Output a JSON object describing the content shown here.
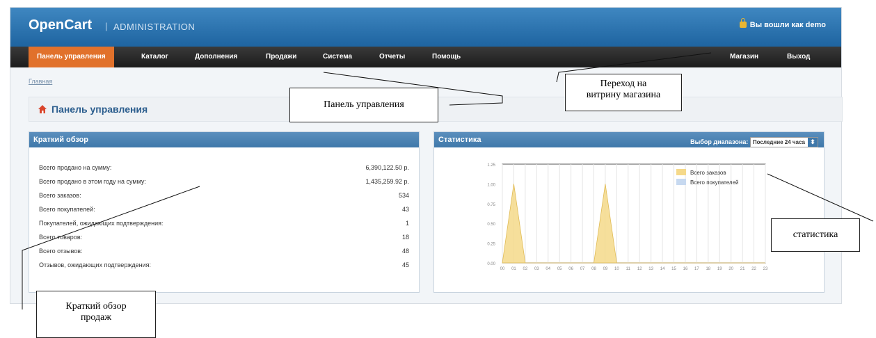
{
  "header": {
    "brand": "OpenCart",
    "separator": "|",
    "subtitle": "ADMINISTRATION",
    "login_text": "Вы вошли как demo"
  },
  "menu": {
    "items": [
      "Панель управления",
      "Каталог",
      "Дополнения",
      "Продажи",
      "Система",
      "Отчеты",
      "Помощь"
    ],
    "right": [
      "Магазин",
      "Выход"
    ]
  },
  "breadcrumb": "Главная",
  "page_title": "Панель управления",
  "overview": {
    "title": "Краткий обзор",
    "rows": [
      {
        "label": "Всего продано на сумму:",
        "value": "6,390,122.50 р."
      },
      {
        "label": "Всего продано в этом году на сумму:",
        "value": "1,435,259.92 р."
      },
      {
        "label": "Всего заказов:",
        "value": "534"
      },
      {
        "label": "Всего покупателей:",
        "value": "43"
      },
      {
        "label": "Покупателей, ожидающих подтверждения:",
        "value": "1"
      },
      {
        "label": "Всего товаров:",
        "value": "18"
      },
      {
        "label": "Всего отзывов:",
        "value": "48"
      },
      {
        "label": "Отзывов, ожидающих подтверждения:",
        "value": "45"
      }
    ]
  },
  "stats": {
    "title": "Статистика",
    "range_label": "Выбор диапазона:",
    "range_value": "Последние 24 часа"
  },
  "chart_data": {
    "type": "area",
    "x": [
      "00",
      "01",
      "02",
      "03",
      "04",
      "05",
      "06",
      "07",
      "08",
      "09",
      "10",
      "11",
      "12",
      "13",
      "14",
      "15",
      "16",
      "17",
      "18",
      "19",
      "20",
      "21",
      "22",
      "23"
    ],
    "yticks": [
      "0.00",
      "0.25",
      "0.50",
      "0.75",
      "1.00",
      "1.25"
    ],
    "ylim": [
      0,
      1.25
    ],
    "series": [
      {
        "name": "Всего заказов",
        "color": "#f5d98a",
        "values": [
          0,
          1,
          0,
          0,
          0,
          0,
          0,
          0,
          0,
          1,
          0,
          0,
          0,
          0,
          0,
          0,
          0,
          0,
          0,
          0,
          0,
          0,
          0,
          0
        ]
      },
      {
        "name": "Всего покупателей",
        "color": "#c7d9f0",
        "values": [
          0,
          0,
          0,
          0,
          0,
          0,
          0,
          0,
          0,
          0,
          0,
          0,
          0,
          0,
          0,
          0,
          0,
          0,
          0,
          0,
          0,
          0,
          0,
          0
        ]
      }
    ],
    "legend_position": "top-right"
  },
  "annotations": {
    "panel": "Панель управления",
    "store_line1": "Переход на",
    "store_line2": "витрину магазина",
    "stats": "статистика",
    "overview_line1": "Краткий обзор",
    "overview_line2": "продаж"
  }
}
